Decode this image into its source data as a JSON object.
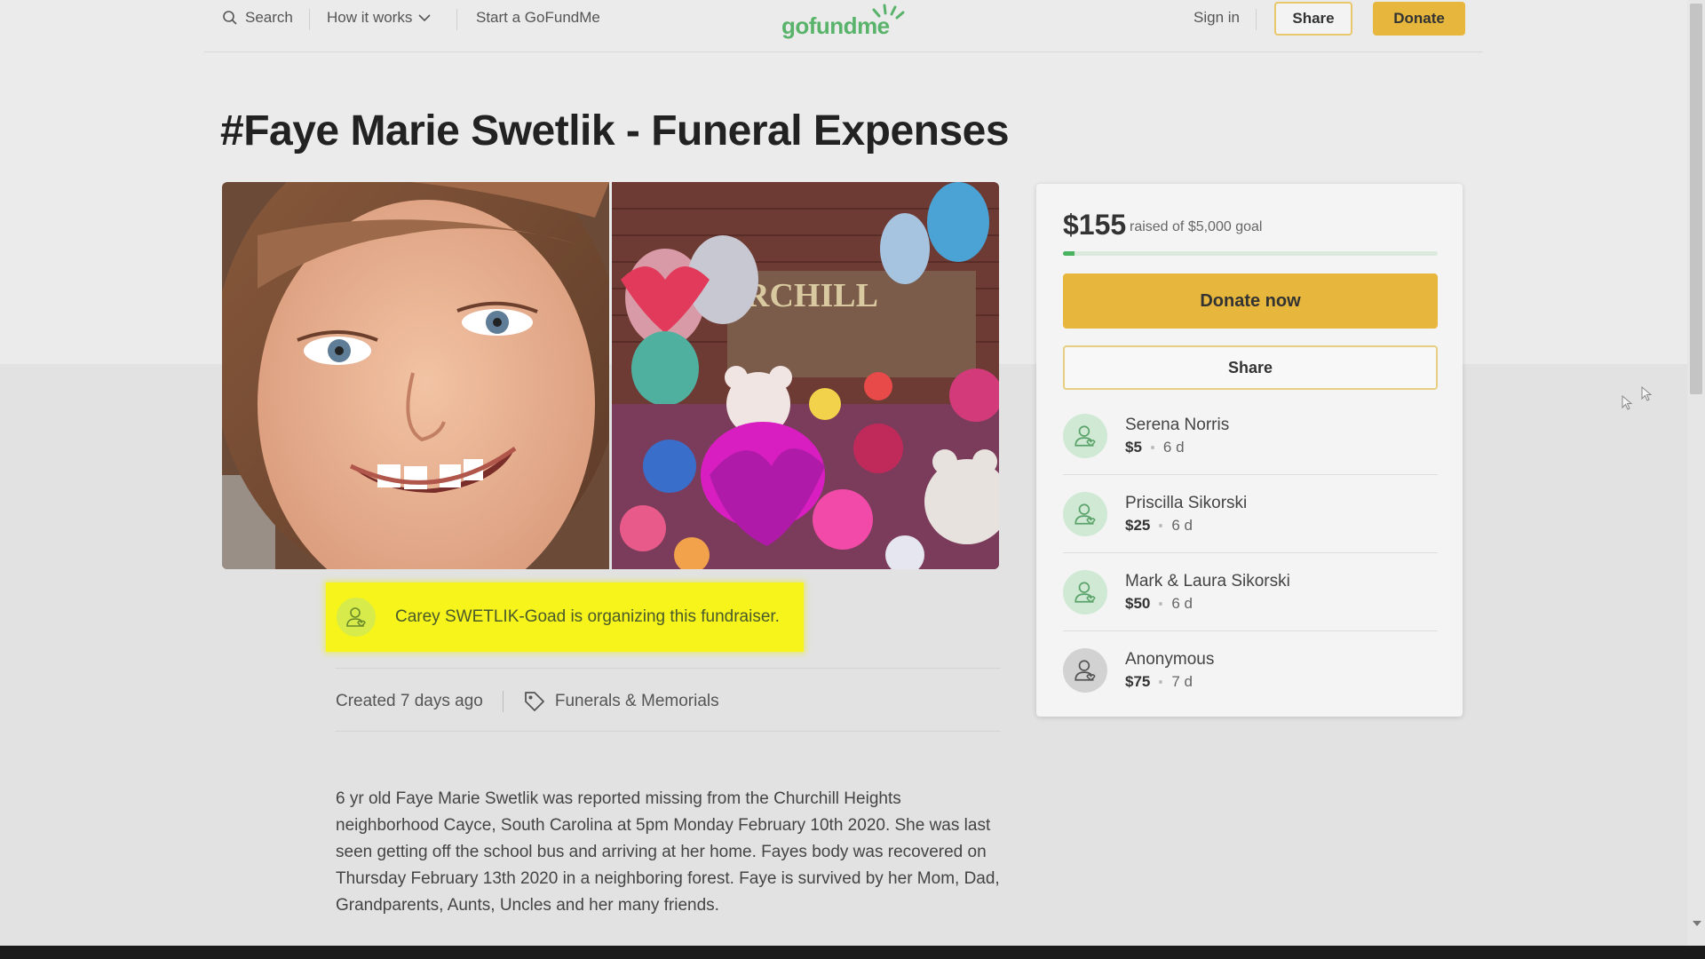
{
  "header": {
    "search_label": "Search",
    "how_label": "How it works",
    "start_label": "Start a GoFundMe",
    "logo_text": "gofundme",
    "signin_label": "Sign in",
    "share_label": "Share",
    "donate_label": "Donate"
  },
  "campaign": {
    "title": "#Faye Marie Swetlik - Funeral Expenses",
    "organizer_text": "Carey SWETLIK-Goad is organizing this fundraiser.",
    "created": "Created 7 days ago",
    "category": "Funerals & Memorials",
    "story": "6 yr old Faye Marie Swetlik was reported missing from the Churchill Heights neighborhood Cayce, South Carolina at 5pm Monday February 10th 2020. She was last seen getting off the school bus and arriving at her home. Fayes body was recovered on Thursday February 13th 2020 in a neighboring forest. Faye is survived by her Mom, Dad, Grandparents, Aunts, Uncles and her many friends.",
    "sign_text": "RCHILL"
  },
  "card": {
    "raised": "$155",
    "goal_text": "raised of $5,000 goal",
    "progress_fraction": 0.031,
    "donate_now_label": "Donate now",
    "share_label": "Share",
    "donors": [
      {
        "name": "Serena Norris",
        "amount": "$5",
        "time": "6 d",
        "avatar_color": "#cfe9d4"
      },
      {
        "name": "Priscilla Sikorski",
        "amount": "$25",
        "time": "6 d",
        "avatar_color": "#cfe9d4"
      },
      {
        "name": "Mark & Laura Sikorski",
        "amount": "$50",
        "time": "6 d",
        "avatar_color": "#cfe9d4"
      },
      {
        "name": "Anonymous",
        "amount": "$75",
        "time": "7 d",
        "avatar_color": "#d2d2d2"
      }
    ]
  },
  "colors": {
    "brand_green": "#59b36a",
    "donate_yellow": "#e6b73c",
    "highlight": "#f6f41a"
  }
}
